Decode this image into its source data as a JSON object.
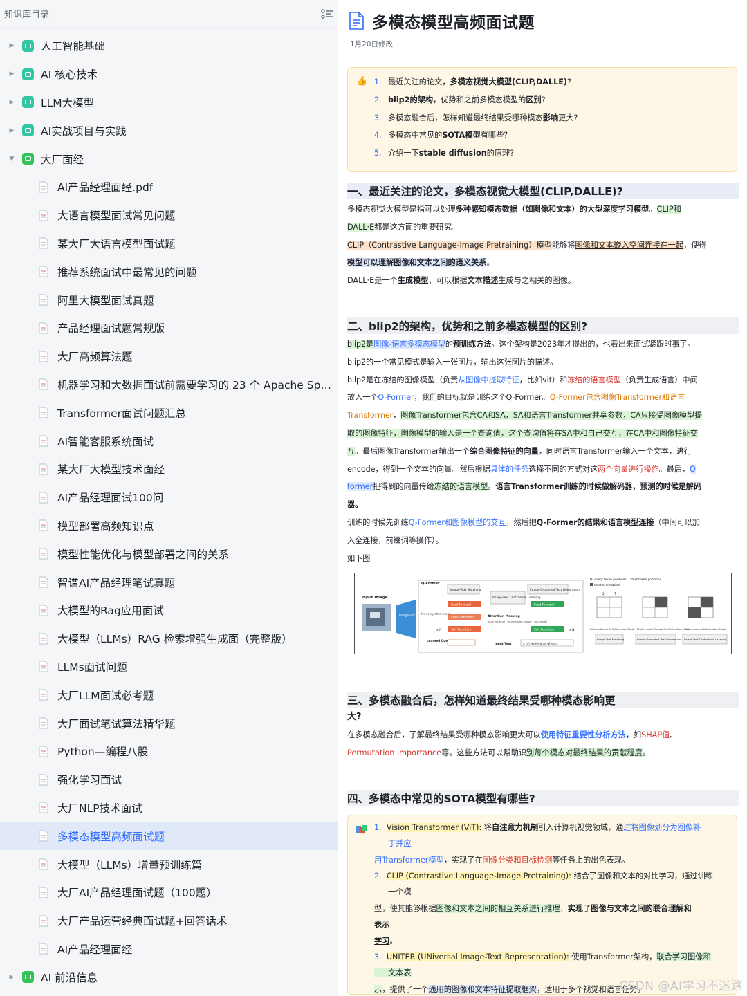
{
  "sidebar": {
    "title": "知识库目录",
    "folders_top": [
      {
        "label": "人工智能基础"
      },
      {
        "label": "AI 核心技术"
      },
      {
        "label": "LLM大模型"
      },
      {
        "label": "AI实战项目与实践"
      },
      {
        "label": "大厂面经"
      }
    ],
    "children": [
      {
        "label": "AI产品经理面经.pdf"
      },
      {
        "label": "大语言模型面试常见问题"
      },
      {
        "label": "某大厂大语言模型面试题"
      },
      {
        "label": "推荐系统面试中最常见的问题"
      },
      {
        "label": "阿里大模型面试真题"
      },
      {
        "label": "产品经理面试题常规版"
      },
      {
        "label": "大厂高频算法题"
      },
      {
        "label": "机器学习和大数据面试前需要学习的 23 个 Apache Spark"
      },
      {
        "label": "Transformer面试问题汇总"
      },
      {
        "label": "AI智能客服系统面试"
      },
      {
        "label": "某大厂大模型技术面经"
      },
      {
        "label": "AI产品经理面试100问"
      },
      {
        "label": "模型部署高频知识点"
      },
      {
        "label": "模型性能优化与模型部署之间的关系"
      },
      {
        "label": "智谱AI产品经理笔试真题"
      },
      {
        "label": "大模型的Rag应用面试"
      },
      {
        "label": "大模型（LLMs）RAG 检索增强生成面（完整版）"
      },
      {
        "label": "LLMs面试问题"
      },
      {
        "label": "大厂LLM面试必考题"
      },
      {
        "label": "大厂面试笔试算法精华题"
      },
      {
        "label": "Python—编程八股"
      },
      {
        "label": "强化学习面试"
      },
      {
        "label": "大厂NLP技术面试"
      },
      {
        "label": "多模态模型高频面试题"
      },
      {
        "label": "大模型（LLMs）增量预训练篇"
      },
      {
        "label": "大厂AI产品经理面试题（100题）"
      },
      {
        "label": "大厂产品运营经典面试题+回答话术"
      },
      {
        "label": "AI产品经理面经"
      }
    ],
    "folder_bottom": {
      "label": "AI 前沿信息"
    }
  },
  "doc": {
    "title": "多模态模型高频面试题",
    "modified": "1月20日修改",
    "toc": {
      "q1_a": "最近关注的论文，",
      "q1_b": "多模态视觉大模型(CLIP,DALLE)",
      "q1_c": "?",
      "q2_a": "blip2的架构",
      "q2_b": "，优势和之前多模态模型的",
      "q2_c": "区别",
      "q2_d": "?",
      "q3_a": "多模态融合后，怎样知道最终结果受哪种模态",
      "q3_b": "影响",
      "q3_c": "更大?",
      "q4_a": "多模态中常见的",
      "q4_b": "SOTA模型",
      "q4_c": "有哪些?",
      "q5_a": "介绍一下",
      "q5_b": "stable diffusion",
      "q5_c": "的原理?",
      "nums": [
        "1.",
        "2.",
        "3.",
        "4.",
        "5."
      ]
    },
    "s1": {
      "heading": "一、最近关注的论文，多模态视觉大模型(CLIP,DALLE)?",
      "p1_a": "多模态视觉大模型是指可以处理",
      "p1_b": "多种感知模态数据（如图像和文本）的大型深度学习模型",
      "p1_c": "。",
      "p1_d": "CLIP和",
      "p1_e": "DALL·E",
      "p1_f": "都是这方面的重要研究。",
      "p2_a": "CLIP（Contrastive Language-Image Pretraining）模型",
      "p2_b": "能够将",
      "p2_c": "图像和文本嵌入空间连接在一起",
      "p2_d": "，使得",
      "p2_e": "模型可以理解图像和文本之间的语义关系",
      "p2_f": "。",
      "p3_a": "DALL·E是一个",
      "p3_b": "生成模型",
      "p3_c": "，可以根据",
      "p3_d": "文本描述",
      "p3_e": "生成与之相关的图像。"
    },
    "s2": {
      "heading": "二、blip2的架构，优势和之前多模态模型的区别?",
      "l1_a": "blip2是",
      "l1_b": "图像-语言多模态模型",
      "l1_c": "的",
      "l1_d": "预训练方法",
      "l1_e": "。这个架构是2023年才提出的，也着出来面试紧跟时事了。",
      "l2": "blip2的一个常见模式是输入一张图片，输出这张图片的描述。",
      "l3_a": "bilp2是在冻结的图像模型（负责",
      "l3_b": "从图像中提取特征",
      "l3_c": "，比如vit）和",
      "l3_d": "冻结的语言模型",
      "l3_e": "（负责生成语言）中间",
      "l4_a": "放入一个",
      "l4_b": "Q-Former",
      "l4_c": "，我们的目标就是训练这个Q-Former。",
      "l4_d": "Q-Former包含图像Transformer和语言",
      "l5_a": "Transformer",
      "l5_b": "，",
      "l5_c": "图像Transformer包含CA和SA，SA和语言Transformer共享参数，CA只接受图像模型提",
      "l6_a": "取的图像特征，图像模型的输入是一个查询值，这个查询值将在SA中和自己交互，在CA中和图像特征交",
      "l7_a": "互",
      "l7_b": "。最后图像Transformer输出一个",
      "l7_c": "综合图像特征的向量",
      "l7_d": "，同时语言Transformer输入一个文本，进行",
      "l8_a": "encode，得到一个文本的向量。然后根据",
      "l8_b": "具体的任务",
      "l8_c": "选择不同的方式对这",
      "l8_d": "两个向量进行操作",
      "l8_e": "。最后，",
      "l8_f": "Q",
      "l9_a": "former",
      "l9_b": "把得到的向量传给",
      "l9_c": "冻结的语言模型",
      "l9_d": "。",
      "l9_e": "语言Transformer训练的时候做解码器，预测的时候是解码",
      "l10": "器。",
      "l11_a": "训练的时候先训练",
      "l11_b": "Q-Former和图像模型的交互",
      "l11_c": "，然后把",
      "l11_d": "Q-Former的结果和语言模型连接",
      "l11_e": "（中间可以加",
      "l12": "入全连接，前缀词等操作）。",
      "l13": "如下图"
    },
    "figure": {
      "input_image": "Input Image",
      "image_encoder": "Image Encoder",
      "qformer": "Q-Former",
      "itm": "Image-Text Matching",
      "itc": "Image-Text Contrastive Learning",
      "itg": "Image-Grounded Text Generation",
      "ff1": "Feed Forward",
      "ff2": "Feed Forward",
      "ca": "Cross Attention",
      "sa1": "Self Attention",
      "sa2": "Self Attention",
      "every_other": "for every other block",
      "xn1": "x N",
      "xn2": "x N",
      "attn_mask": "Attention Masking",
      "mask_sub": "bi-directional / multimodal causal / uni-modal",
      "learned_queries": "Learned Queries",
      "input_text": "Input Text",
      "caption": "a cat wearing sunglasses",
      "legend": "Q: query token positions;  T: text token positions.",
      "legend2": "masked  unmasked",
      "m1": "Bi-directional Self-Attention Mask",
      "m2": "Multi-modal Causal Self-Attention Mask",
      "m3": "Uni-modal Self-Attention Mask",
      "b1": "Image-Text Matching",
      "b2": "Image-Grounded Text Generation",
      "b3": "Image-Text Contrastive Learning",
      "q": "Q",
      "t": "T"
    },
    "s3": {
      "heading": "三、多模态融合后，怎样知道最终结果受哪种模态影响更",
      "heading_cont": "大?",
      "p_a": "在多模态融合后，了解最终结果受哪种模态影响更大可以",
      "p_b": "使用特征重要性分析方法",
      "p_c": "，如",
      "p_d": "SHAP值",
      "p_e": "、",
      "p2_a": "Permutation Importance",
      "p2_b": "等。这些方法可以帮助识",
      "p2_c": "别每个模态对最终结果的贡献程度",
      "p2_d": "。"
    },
    "s4": {
      "heading": "四、多模态中常见的SOTA模型有哪些?",
      "i1_num": "1.",
      "i1_a": "Vision Transformer (ViT):",
      "i1_b": " 将",
      "i1_c": "自注意力机制",
      "i1_d": "引入计算机视觉领域，通",
      "i1_e": "过将图像划分为图像补",
      "i1_f": "丁并应",
      "i1g_a": "用Transformer模型",
      "i1g_b": "，实现了在",
      "i1g_c": "图像分类和目标检测",
      "i1g_d": "等任务上的出色表现。",
      "i2_num": "2.",
      "i2_a": "CLIP (Contrastive Language-Image Pretraining):",
      "i2_b": " 结合了图像和文本的对比学习，通过训练",
      "i2_c": "一个模",
      "i2g_a": "型，使其能够根据",
      "i2g_b": "图像和文本之间的相互关系进行推理",
      "i2g_c": "，",
      "i2g_d": "实现了图像与文本之间的联合理解和",
      "i2g_e": "表示",
      "i2h": "学习",
      "i2h_dot": "。",
      "i3_num": "3.",
      "i3_a": "UNITER (UNiversal Image-Text Representation):",
      "i3_b": " 使用Transformer架构，",
      "i3_c": "联合学习图像和",
      "i3_d": "文本表",
      "i3g_a": "示",
      "i3g_b": "，提供了一个",
      "i3g_c": "通用的图像和文本特征提取框架",
      "i3g_d": "，适用于多个视觉和语言任务。"
    },
    "watermark": "CSDN @AI学习不迷路"
  },
  "colors": {
    "accent": "#3370ff",
    "sidebar_bg": "#f5f6f7",
    "active_bg": "#e1e8f7",
    "callout_bg": "#fef7e6",
    "highlight_blue": "#dfe8fb",
    "highlight_green": "#d9f5d6",
    "highlight_yellow": "#fff3b8",
    "red_text": "#d83931",
    "folder_teal": "#34c5a3"
  },
  "icons": {
    "outline_toggle": "list-outline-icon",
    "folder": "folder-icon",
    "document": "doc-icon",
    "page": "page-doc-icon",
    "thumbs_up": "thumbs-up-icon",
    "books": "books-icon",
    "caret_right": "caret-right-icon",
    "caret_down": "caret-down-icon"
  }
}
